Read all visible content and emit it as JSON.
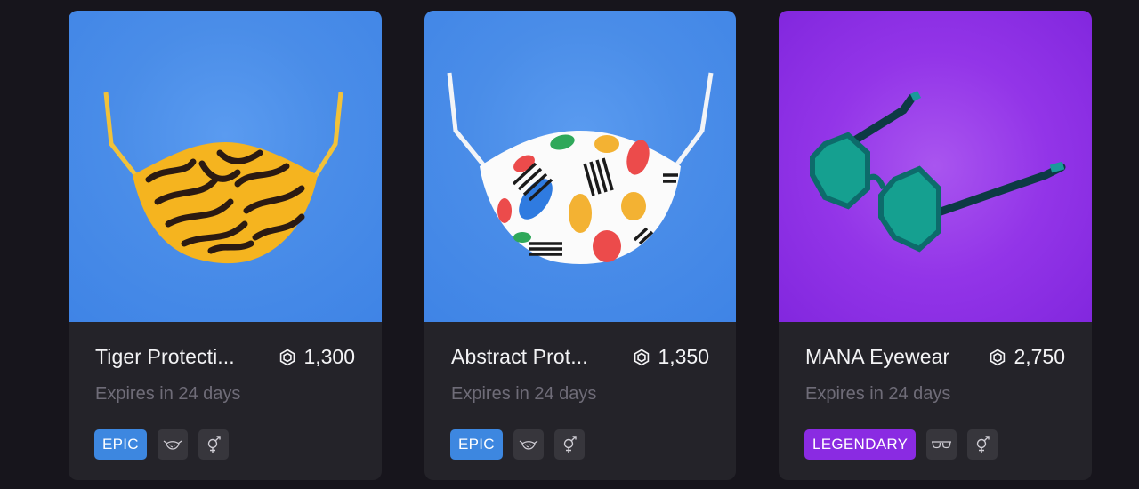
{
  "cards": [
    {
      "title": "Tiger Protecti...",
      "price": "1,300",
      "expires": "Expires in 24 days",
      "rarity": "EPIC",
      "category_icon": "mask-icon",
      "gender_icon": "unisex-icon"
    },
    {
      "title": "Abstract Prot...",
      "price": "1,350",
      "expires": "Expires in 24 days",
      "rarity": "EPIC",
      "category_icon": "mask-icon",
      "gender_icon": "unisex-icon"
    },
    {
      "title": "MANA Eyewear",
      "price": "2,750",
      "expires": "Expires in 24 days",
      "rarity": "LEGENDARY",
      "category_icon": "eyewear-icon",
      "gender_icon": "unisex-icon"
    }
  ],
  "colors": {
    "background": "#17151c",
    "card": "#242329",
    "epic": "#3d87e0",
    "legendary": "#8a2be2",
    "muted_text": "#6f6c78"
  }
}
